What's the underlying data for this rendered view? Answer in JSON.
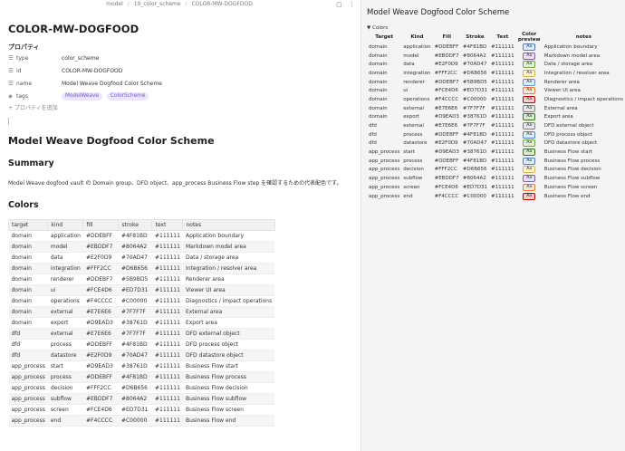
{
  "breadcrumb": [
    "model",
    "10_color_scheme",
    "COLOR-MW-DOGFOOD"
  ],
  "note_title": "COLOR-MW-DOGFOOD",
  "properties": {
    "header": "プロパティ",
    "rows": [
      {
        "key": "type",
        "value": "color_scheme",
        "icon": "list-icon"
      },
      {
        "key": "id",
        "value": "COLOR-MW-DOGFOOD",
        "icon": "list-icon"
      },
      {
        "key": "name",
        "value": "Model Weave Dogfood Color Scheme",
        "icon": "list-icon"
      }
    ],
    "tags_key": "tags",
    "tags": [
      "ModelWeave",
      "ColorScheme"
    ],
    "add_label": "プロパティを追加"
  },
  "heading": "Model Weave Dogfood Color Scheme",
  "summary_heading": "Summary",
  "summary_text": "Model Weave dogfood vault の Domain group、DFD object、app_process Business Flow step を確認するための代表配色です。",
  "colors_heading": "Colors",
  "table_headers": [
    "target",
    "kind",
    "fill",
    "stroke",
    "text",
    "notes"
  ],
  "colors": [
    {
      "target": "domain",
      "kind": "application",
      "fill": "#DDEBFF",
      "stroke": "#4F81BD",
      "text": "#111111",
      "notes": "Application boundary"
    },
    {
      "target": "domain",
      "kind": "model",
      "fill": "#EBDDF7",
      "stroke": "#8064A2",
      "text": "#111111",
      "notes": "Markdown model area"
    },
    {
      "target": "domain",
      "kind": "data",
      "fill": "#E2F0D9",
      "stroke": "#70AD47",
      "text": "#111111",
      "notes": "Data / storage area"
    },
    {
      "target": "domain",
      "kind": "integration",
      "fill": "#FFF2CC",
      "stroke": "#D6B656",
      "text": "#111111",
      "notes": "Integration / resolver area"
    },
    {
      "target": "domain",
      "kind": "renderer",
      "fill": "#DDEBF7",
      "stroke": "#5B9BD5",
      "text": "#111111",
      "notes": "Renderer area"
    },
    {
      "target": "domain",
      "kind": "ui",
      "fill": "#FCE4D6",
      "stroke": "#ED7D31",
      "text": "#111111",
      "notes": "Viewer UI area"
    },
    {
      "target": "domain",
      "kind": "operations",
      "fill": "#F4CCCC",
      "stroke": "#C00000",
      "text": "#111111",
      "notes": "Diagnostics / impact operations"
    },
    {
      "target": "domain",
      "kind": "external",
      "fill": "#E7E6E6",
      "stroke": "#7F7F7F",
      "text": "#111111",
      "notes": "External area"
    },
    {
      "target": "domain",
      "kind": "export",
      "fill": "#D9EAD3",
      "stroke": "#38761D",
      "text": "#111111",
      "notes": "Export area"
    },
    {
      "target": "dfd",
      "kind": "external",
      "fill": "#E7E6E6",
      "stroke": "#7F7F7F",
      "text": "#111111",
      "notes": "DFD external object"
    },
    {
      "target": "dfd",
      "kind": "process",
      "fill": "#DDEBFF",
      "stroke": "#4F81BD",
      "text": "#111111",
      "notes": "DFD process object"
    },
    {
      "target": "dfd",
      "kind": "datastore",
      "fill": "#E2F0D9",
      "stroke": "#70AD47",
      "text": "#111111",
      "notes": "DFD datastore object"
    },
    {
      "target": "app_process",
      "kind": "start",
      "fill": "#D9EAD3",
      "stroke": "#38761D",
      "text": "#111111",
      "notes": "Business Flow start"
    },
    {
      "target": "app_process",
      "kind": "process",
      "fill": "#DDEBFF",
      "stroke": "#4F81BD",
      "text": "#111111",
      "notes": "Business Flow process"
    },
    {
      "target": "app_process",
      "kind": "decision",
      "fill": "#FFF2CC",
      "stroke": "#D6B656",
      "text": "#111111",
      "notes": "Business Flow decision"
    },
    {
      "target": "app_process",
      "kind": "subflow",
      "fill": "#EBDDF7",
      "stroke": "#8064A2",
      "text": "#111111",
      "notes": "Business Flow subflow"
    },
    {
      "target": "app_process",
      "kind": "screen",
      "fill": "#FCE4D6",
      "stroke": "#ED7D31",
      "text": "#111111",
      "notes": "Business Flow screen"
    },
    {
      "target": "app_process",
      "kind": "end",
      "fill": "#F4CCCC",
      "stroke": "#C00000",
      "text": "#111111",
      "notes": "Business Flow end"
    }
  ],
  "preview_panel": {
    "title": "Model Weave Dogfood Color Scheme",
    "section_label": "Colors",
    "headers": [
      "Target",
      "Kind",
      "Fill",
      "Stroke",
      "Text",
      "Color preview",
      "notes"
    ],
    "swatch_text": "Aa"
  },
  "accent_color": "#7a55d6"
}
